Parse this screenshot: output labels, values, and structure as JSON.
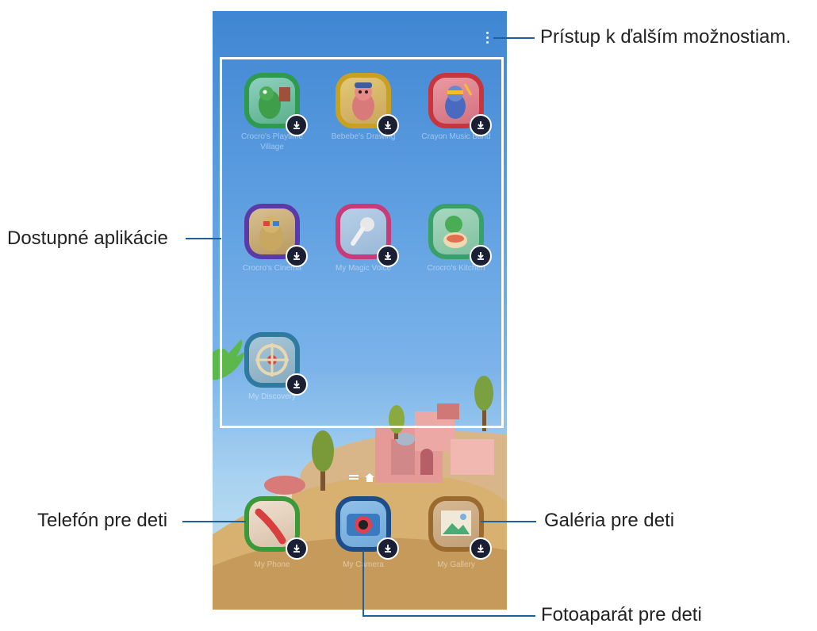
{
  "callouts": {
    "more_options": "Prístup k ďalším možnostiam.",
    "available_apps": "Dostupné aplikácie",
    "kids_phone": "Telefón pre deti",
    "kids_gallery": "Galéria pre deti",
    "kids_camera": "Fotoaparát pre deti"
  },
  "phone": {
    "apps": [
      {
        "name": "Crocro's Playtime Village",
        "color": "#2e9a4e"
      },
      {
        "name": "Bebebe's Drawing",
        "color": "#c9a020"
      },
      {
        "name": "Crayon Music Band",
        "color": "#c7363e"
      },
      {
        "name": "Crocro's Cinema",
        "color": "#5a3aa8"
      },
      {
        "name": "My Magic Voice",
        "color": "#c83a78"
      },
      {
        "name": "Crocro's Kitchen",
        "color": "#3aa06a"
      },
      {
        "name": "My Discovery",
        "color": "#2e7aa0"
      }
    ],
    "dock": [
      {
        "name": "My Phone",
        "color": "#3a9a3a"
      },
      {
        "name": "My Camera",
        "color": "#1d4e8a"
      },
      {
        "name": "My Gallery",
        "color": "#9a6a2e"
      }
    ]
  }
}
